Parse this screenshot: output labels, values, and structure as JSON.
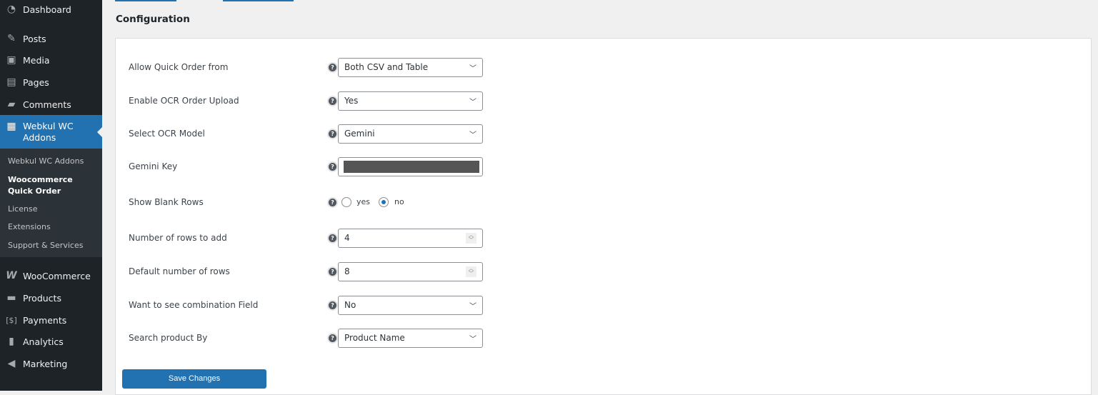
{
  "sidebar": {
    "items": [
      {
        "label": "Dashboard",
        "icon": "dashboard-icon"
      },
      {
        "label": "Posts",
        "icon": "pin-icon"
      },
      {
        "label": "Media",
        "icon": "media-icon"
      },
      {
        "label": "Pages",
        "icon": "pages-icon"
      },
      {
        "label": "Comments",
        "icon": "comment-icon"
      },
      {
        "label": "Webkul WC Addons",
        "icon": "webkul-bag-icon"
      },
      {
        "label": "WooCommerce",
        "icon": "woo-icon"
      },
      {
        "label": "Products",
        "icon": "archive-icon"
      },
      {
        "label": "Payments",
        "icon": "dollar-icon"
      },
      {
        "label": "Analytics",
        "icon": "bar-chart-icon"
      },
      {
        "label": "Marketing",
        "icon": "megaphone-icon"
      }
    ],
    "submenu": [
      "Webkul WC Addons",
      "Woocommerce Quick Order",
      "License",
      "Extensions",
      "Support & Services"
    ]
  },
  "main": {
    "title": "Configuration",
    "help_glyph": "?",
    "fields": [
      {
        "label": "Allow Quick Order from",
        "value": "Both CSV and Table"
      },
      {
        "label": "Enable OCR Order Upload",
        "value": "Yes"
      },
      {
        "label": "Select OCR Model",
        "value": "Gemini"
      },
      {
        "label": "Gemini Key"
      },
      {
        "label": "Show Blank Rows",
        "options": [
          "yes",
          "no"
        ],
        "selected": "no"
      },
      {
        "label": "Number of rows to add",
        "value": "4"
      },
      {
        "label": "Default number of rows",
        "value": "8"
      },
      {
        "label": "Want to see combination Field",
        "value": "No"
      },
      {
        "label": "Search product By",
        "value": "Product Name"
      }
    ],
    "save_label": "Save Changes"
  }
}
